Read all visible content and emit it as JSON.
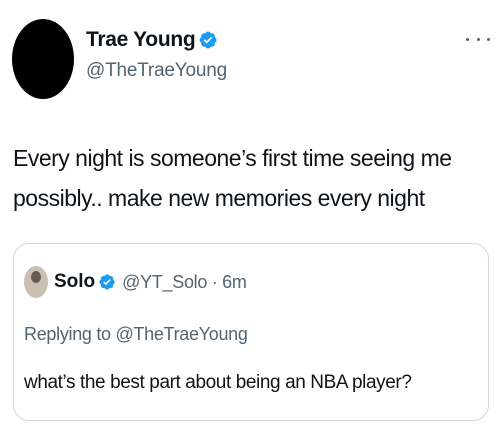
{
  "author": {
    "display_name": "Trae Young",
    "handle": "@TheTraeYoung",
    "verified_icon": "verified-badge-icon"
  },
  "tweet": {
    "text": "Every night is someone’s first time seeing me possibly.. make new memories every night"
  },
  "quoted": {
    "display_name": "Solo",
    "meta": "@YT_Solo · 6m",
    "replying_to": "Replying to @TheTraeYoung",
    "text": "what’s the best part about being an NBA player?"
  },
  "colors": {
    "text": "#0f1419",
    "secondary": "#536471",
    "verified": "#1d9bf0",
    "border": "#cfd9de"
  }
}
